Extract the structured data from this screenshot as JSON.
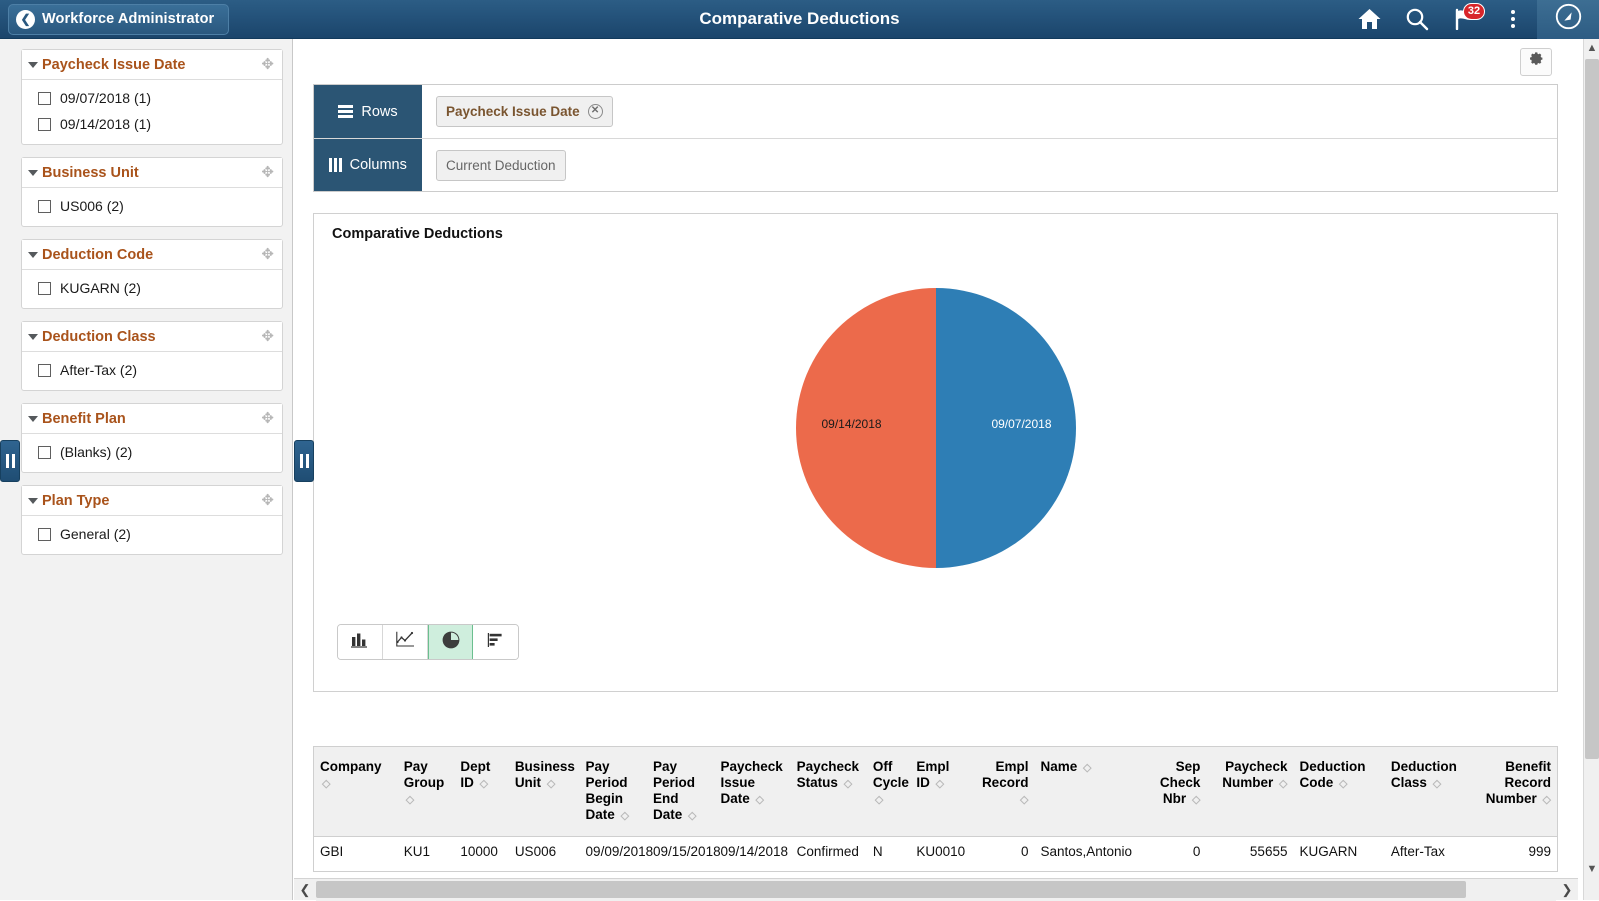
{
  "header": {
    "back_label": "Workforce Administrator",
    "back_icon": "chevron-left-icon",
    "title": "Comparative Deductions",
    "home_icon": "home-icon",
    "search_icon": "search-icon",
    "notifications_icon": "flag-icon",
    "notifications_count": "32",
    "actions_icon": "kebab-menu-icon",
    "nav_icon": "navbar-compass-icon"
  },
  "sidebar": {
    "facets": [
      {
        "title": "Paycheck Issue Date",
        "move_icon": "move-handle-icon",
        "items": [
          {
            "label": "09/07/2018 (1)"
          },
          {
            "label": "09/14/2018 (1)"
          }
        ]
      },
      {
        "title": "Business Unit",
        "move_icon": "move-handle-icon",
        "items": [
          {
            "label": "US006 (2)"
          }
        ]
      },
      {
        "title": "Deduction Code",
        "move_icon": "move-handle-icon",
        "items": [
          {
            "label": "KUGARN (2)"
          }
        ]
      },
      {
        "title": "Deduction Class",
        "move_icon": "move-handle-icon",
        "items": [
          {
            "label": "After-Tax (2)"
          }
        ]
      },
      {
        "title": "Benefit Plan",
        "move_icon": "move-handle-icon",
        "items": [
          {
            "label": "(Blanks) (2)"
          }
        ]
      },
      {
        "title": "Plan Type",
        "move_icon": "move-handle-icon",
        "items": [
          {
            "label": "General (2)"
          }
        ]
      }
    ]
  },
  "toolbar": {
    "gear_icon": "gear-icon"
  },
  "pivot": {
    "rows_label": "Rows",
    "rows_icon": "rows-icon",
    "rows_chip": "Paycheck Issue Date",
    "rows_chip_remove_icon": "remove-circle-icon",
    "columns_label": "Columns",
    "columns_icon": "columns-icon",
    "columns_chip": "Current Deduction"
  },
  "chart_panel": {
    "title": "Comparative Deductions",
    "toggles": [
      {
        "name": "bar-chart",
        "icon": "bar-chart-icon",
        "active": false
      },
      {
        "name": "line-chart",
        "icon": "line-chart-icon",
        "active": false
      },
      {
        "name": "pie-chart",
        "icon": "pie-chart-icon",
        "active": true
      },
      {
        "name": "horizontal-bar-chart",
        "icon": "horizontal-bar-chart-icon",
        "active": false
      }
    ]
  },
  "chart_data": {
    "type": "pie",
    "title": "Comparative Deductions",
    "xlabel": "",
    "ylabel": "",
    "legend_position": "none",
    "grid": false,
    "categories": [
      "09/07/2018",
      "09/14/2018"
    ],
    "values": [
      50,
      50
    ],
    "slices": [
      {
        "label": "09/07/2018",
        "value": 50,
        "percent": 50,
        "color": "#2e7eb5",
        "label_color": "#ffffff",
        "start_angle": 0,
        "end_angle": 180
      },
      {
        "label": "09/14/2018",
        "value": 50,
        "percent": 50,
        "color": "#ec6a4b",
        "label_color": "#1a1a1a",
        "start_angle": 180,
        "end_angle": 360
      }
    ],
    "colors": [
      "#2e7eb5",
      "#ec6a4b"
    ]
  },
  "table": {
    "columns": [
      {
        "label": "Company",
        "sort_icon": "sort-icon",
        "align": "left"
      },
      {
        "label": "Pay Group",
        "sort_icon": "sort-icon",
        "align": "left"
      },
      {
        "label": "Dept ID",
        "sort_icon": "sort-icon",
        "align": "left"
      },
      {
        "label": "Business Unit",
        "sort_icon": "sort-icon",
        "align": "left"
      },
      {
        "label": "Pay Period Begin Date",
        "sort_icon": "sort-icon",
        "align": "left"
      },
      {
        "label": "Pay Period End Date",
        "sort_icon": "sort-icon",
        "align": "left"
      },
      {
        "label": "Paycheck Issue Date",
        "sort_icon": "sort-icon",
        "align": "left"
      },
      {
        "label": "Paycheck Status",
        "sort_icon": "sort-icon",
        "align": "left"
      },
      {
        "label": "Off Cycle",
        "sort_icon": "sort-icon",
        "align": "left"
      },
      {
        "label": "Empl ID",
        "sort_icon": "sort-icon",
        "align": "left"
      },
      {
        "label": "Empl Record",
        "sort_icon": "sort-icon",
        "align": "right"
      },
      {
        "label": "Name",
        "sort_icon": "sort-icon",
        "align": "left"
      },
      {
        "label": "Sep Check Nbr",
        "sort_icon": "sort-icon",
        "align": "right"
      },
      {
        "label": "Paycheck Number",
        "sort_icon": "sort-icon",
        "align": "right"
      },
      {
        "label": "Deduction Code",
        "sort_icon": "sort-icon",
        "align": "left"
      },
      {
        "label": "Deduction Class",
        "sort_icon": "sort-icon",
        "align": "left"
      },
      {
        "label": "Benefit Record Number",
        "sort_icon": "sort-icon",
        "align": "right"
      }
    ],
    "rows": [
      {
        "cells": [
          "GBI",
          "KU1",
          "10000",
          "US006",
          "09/09/2018",
          "09/15/2018",
          "09/14/2018",
          "Confirmed",
          "N",
          "KU0010",
          "0",
          "Santos,Antonio",
          "0",
          "55655",
          "KUGARN",
          "After-Tax",
          "999"
        ]
      }
    ]
  },
  "scrollbars": {
    "h_left_icon": "chevron-left-icon",
    "h_right_icon": "chevron-right-icon",
    "v_up_icon": "chevron-up-icon",
    "v_down_icon": "chevron-down-icon"
  },
  "panel_handles": {
    "left_icon": "collapse-handle-icon",
    "right_icon": "collapse-handle-icon"
  }
}
